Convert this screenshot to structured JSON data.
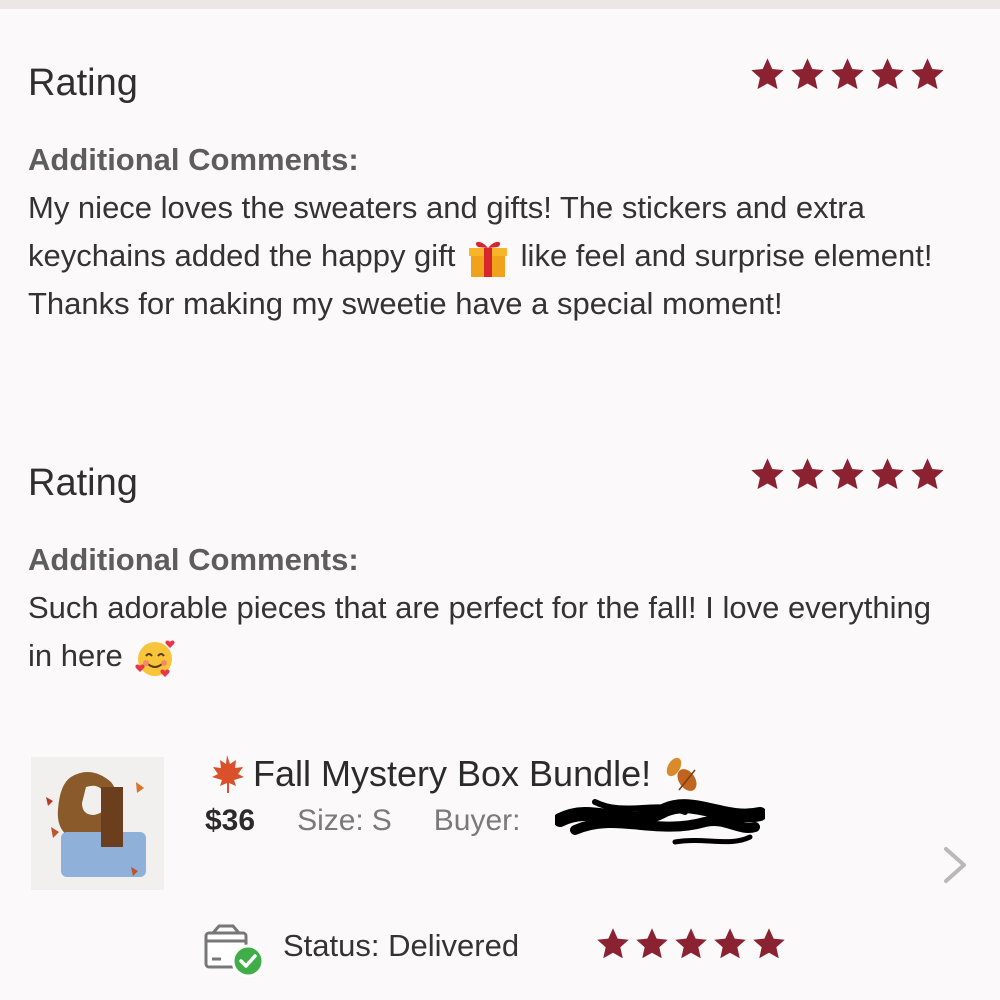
{
  "reviews": [
    {
      "rating_label": "Rating",
      "rating_stars": 5,
      "comments_label": "Additional Comments:",
      "comment_part1": "My niece loves the sweaters and gifts! The stickers and extra keychains added the happy gift",
      "comment_emoji": "gift-emoji",
      "comment_part2": "like feel and surprise element! Thanks for making my sweetie have a special moment!"
    },
    {
      "rating_label": "Rating",
      "rating_stars": 5,
      "comments_label": "Additional Comments:",
      "comment_part1": "Such adorable pieces that are perfect for the fall! I love everything in here",
      "comment_emoji": "smiling-face-with-hearts-emoji",
      "comment_part2": ""
    }
  ],
  "listing": {
    "title": "Fall Mystery Box Bundle!",
    "price": "$36",
    "size_label": "Size:",
    "size_value": "S",
    "buyer_label": "Buyer:",
    "status_label": "Status:",
    "status_value": "Delivered",
    "status_stars": 5
  },
  "colors": {
    "star": "#8b2232",
    "background": "#fbf9f9",
    "check_badge": "#3fae49"
  },
  "icons": {
    "listing_prefix": "maple-leaf-icon",
    "listing_suffix": "fallen-leaves-icon",
    "status": "package-delivered-icon",
    "nav": "chevron-right-icon"
  }
}
